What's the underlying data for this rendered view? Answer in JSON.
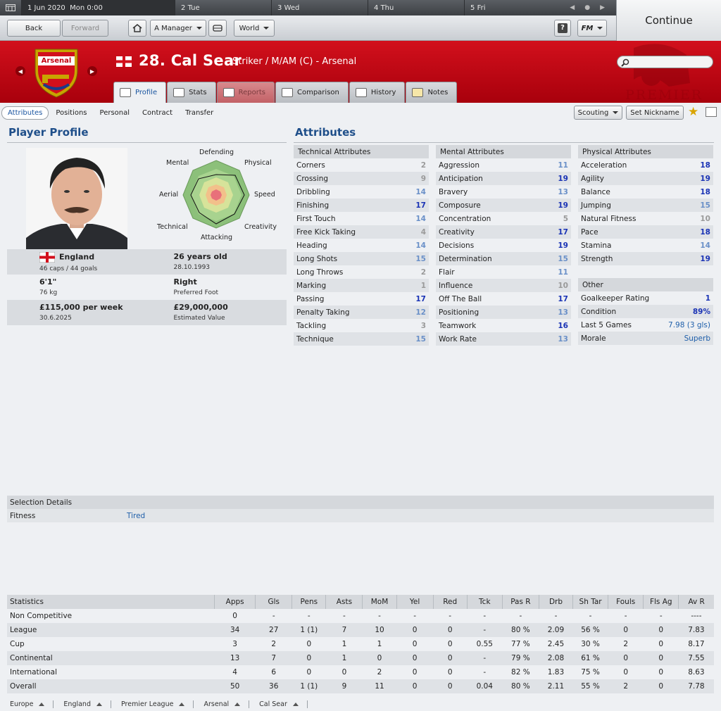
{
  "topbar": {
    "current_date": "1 Jun 2020",
    "current_time": "Mon 0:00",
    "days": [
      {
        "num": "2",
        "name": "Tue"
      },
      {
        "num": "3",
        "name": "Wed"
      },
      {
        "num": "4",
        "name": "Thu"
      },
      {
        "num": "5",
        "name": "Fri"
      }
    ]
  },
  "toolbar": {
    "back": "Back",
    "forward": "Forward",
    "manager": "A Manager",
    "world": "World",
    "help": "?",
    "fm": "FM",
    "continue": "Continue"
  },
  "player": {
    "name": "28. Cal Sear",
    "position": "Striker / M/AM (C) - Arsenal",
    "club_badge_text": "Arsenal",
    "league_logo_text": "PREMIER"
  },
  "tabs": [
    "Profile",
    "Stats",
    "Reports",
    "Comparison",
    "History",
    "Notes"
  ],
  "subnav": [
    "Attributes",
    "Positions",
    "Personal",
    "Contract",
    "Transfer"
  ],
  "actions": {
    "scouting": "Scouting",
    "nickname": "Set Nickname"
  },
  "profile": {
    "title": "Player Profile",
    "radar_labels": [
      "Defending",
      "Physical",
      "Speed",
      "Creativity",
      "Attacking",
      "Technical",
      "Aerial",
      "Mental"
    ],
    "nation": "England",
    "caps": "46 caps / 44 goals",
    "age": "26 years old",
    "dob": "28.10.1993",
    "height": "6'1\"",
    "weight": "76 kg",
    "foot": "Right",
    "foot_label": "Preferred Foot",
    "wage": "£115,000 per week",
    "contract_end": "30.6.2025",
    "value": "£29,000,000",
    "value_label": "Estimated Value"
  },
  "attributes": {
    "title": "Attributes",
    "technical": {
      "header": "Technical Attributes",
      "items": [
        {
          "name": "Corners",
          "value": "2"
        },
        {
          "name": "Crossing",
          "value": "9"
        },
        {
          "name": "Dribbling",
          "value": "14"
        },
        {
          "name": "Finishing",
          "value": "17"
        },
        {
          "name": "First Touch",
          "value": "14"
        },
        {
          "name": "Free Kick Taking",
          "value": "4"
        },
        {
          "name": "Heading",
          "value": "14"
        },
        {
          "name": "Long Shots",
          "value": "15"
        },
        {
          "name": "Long Throws",
          "value": "2"
        },
        {
          "name": "Marking",
          "value": "1"
        },
        {
          "name": "Passing",
          "value": "17"
        },
        {
          "name": "Penalty Taking",
          "value": "12"
        },
        {
          "name": "Tackling",
          "value": "3"
        },
        {
          "name": "Technique",
          "value": "15"
        }
      ]
    },
    "mental": {
      "header": "Mental Attributes",
      "items": [
        {
          "name": "Aggression",
          "value": "11"
        },
        {
          "name": "Anticipation",
          "value": "19"
        },
        {
          "name": "Bravery",
          "value": "13"
        },
        {
          "name": "Composure",
          "value": "19"
        },
        {
          "name": "Concentration",
          "value": "5"
        },
        {
          "name": "Creativity",
          "value": "17"
        },
        {
          "name": "Decisions",
          "value": "19"
        },
        {
          "name": "Determination",
          "value": "15"
        },
        {
          "name": "Flair",
          "value": "11"
        },
        {
          "name": "Influence",
          "value": "10"
        },
        {
          "name": "Off The Ball",
          "value": "17"
        },
        {
          "name": "Positioning",
          "value": "13"
        },
        {
          "name": "Teamwork",
          "value": "16"
        },
        {
          "name": "Work Rate",
          "value": "13"
        }
      ]
    },
    "physical": {
      "header": "Physical Attributes",
      "items": [
        {
          "name": "Acceleration",
          "value": "18"
        },
        {
          "name": "Agility",
          "value": "19"
        },
        {
          "name": "Balance",
          "value": "18"
        },
        {
          "name": "Jumping",
          "value": "15"
        },
        {
          "name": "Natural Fitness",
          "value": "10"
        },
        {
          "name": "Pace",
          "value": "18"
        },
        {
          "name": "Stamina",
          "value": "14"
        },
        {
          "name": "Strength",
          "value": "19"
        }
      ]
    },
    "other": {
      "header": "Other",
      "items": [
        {
          "name": "Goalkeeper Rating",
          "value": "1"
        },
        {
          "name": "Condition",
          "value": "89%"
        },
        {
          "name": "Last 5 Games",
          "value": "7.98 (3 gls)"
        },
        {
          "name": "Morale",
          "value": "Superb"
        }
      ]
    }
  },
  "selection": {
    "header": "Selection Details",
    "label": "Fitness",
    "value": "Tired"
  },
  "statistics": {
    "columns": [
      "Statistics",
      "Apps",
      "Gls",
      "Pens",
      "Asts",
      "MoM",
      "Yel",
      "Red",
      "Tck",
      "Pas R",
      "Drb",
      "Sh Tar",
      "Fouls",
      "Fls Ag",
      "Av R"
    ],
    "rows": [
      [
        "Non Competitive",
        "0",
        "-",
        "-",
        "-",
        "-",
        "-",
        "-",
        "-",
        "-",
        "-",
        "-",
        "-",
        "-",
        "----"
      ],
      [
        "League",
        "34",
        "27",
        "1 (1)",
        "7",
        "10",
        "0",
        "0",
        "-",
        "80 %",
        "2.09",
        "56 %",
        "0",
        "0",
        "7.83"
      ],
      [
        "Cup",
        "3",
        "2",
        "0",
        "1",
        "1",
        "0",
        "0",
        "0.55",
        "77 %",
        "2.45",
        "30 %",
        "2",
        "0",
        "8.17"
      ],
      [
        "Continental",
        "13",
        "7",
        "0",
        "1",
        "0",
        "0",
        "0",
        "-",
        "79 %",
        "2.08",
        "61 %",
        "0",
        "0",
        "7.55"
      ],
      [
        "International",
        "4",
        "6",
        "0",
        "0",
        "2",
        "0",
        "0",
        "-",
        "82 %",
        "1.83",
        "75 %",
        "0",
        "0",
        "8.63"
      ],
      [
        "Overall",
        "50",
        "36",
        "1 (1)",
        "9",
        "11",
        "0",
        "0",
        "0.04",
        "80 %",
        "2.11",
        "55 %",
        "2",
        "0",
        "7.78"
      ]
    ]
  },
  "breadcrumb": [
    "Europe",
    "England",
    "Premier League",
    "Arsenal",
    "Cal Sear"
  ]
}
